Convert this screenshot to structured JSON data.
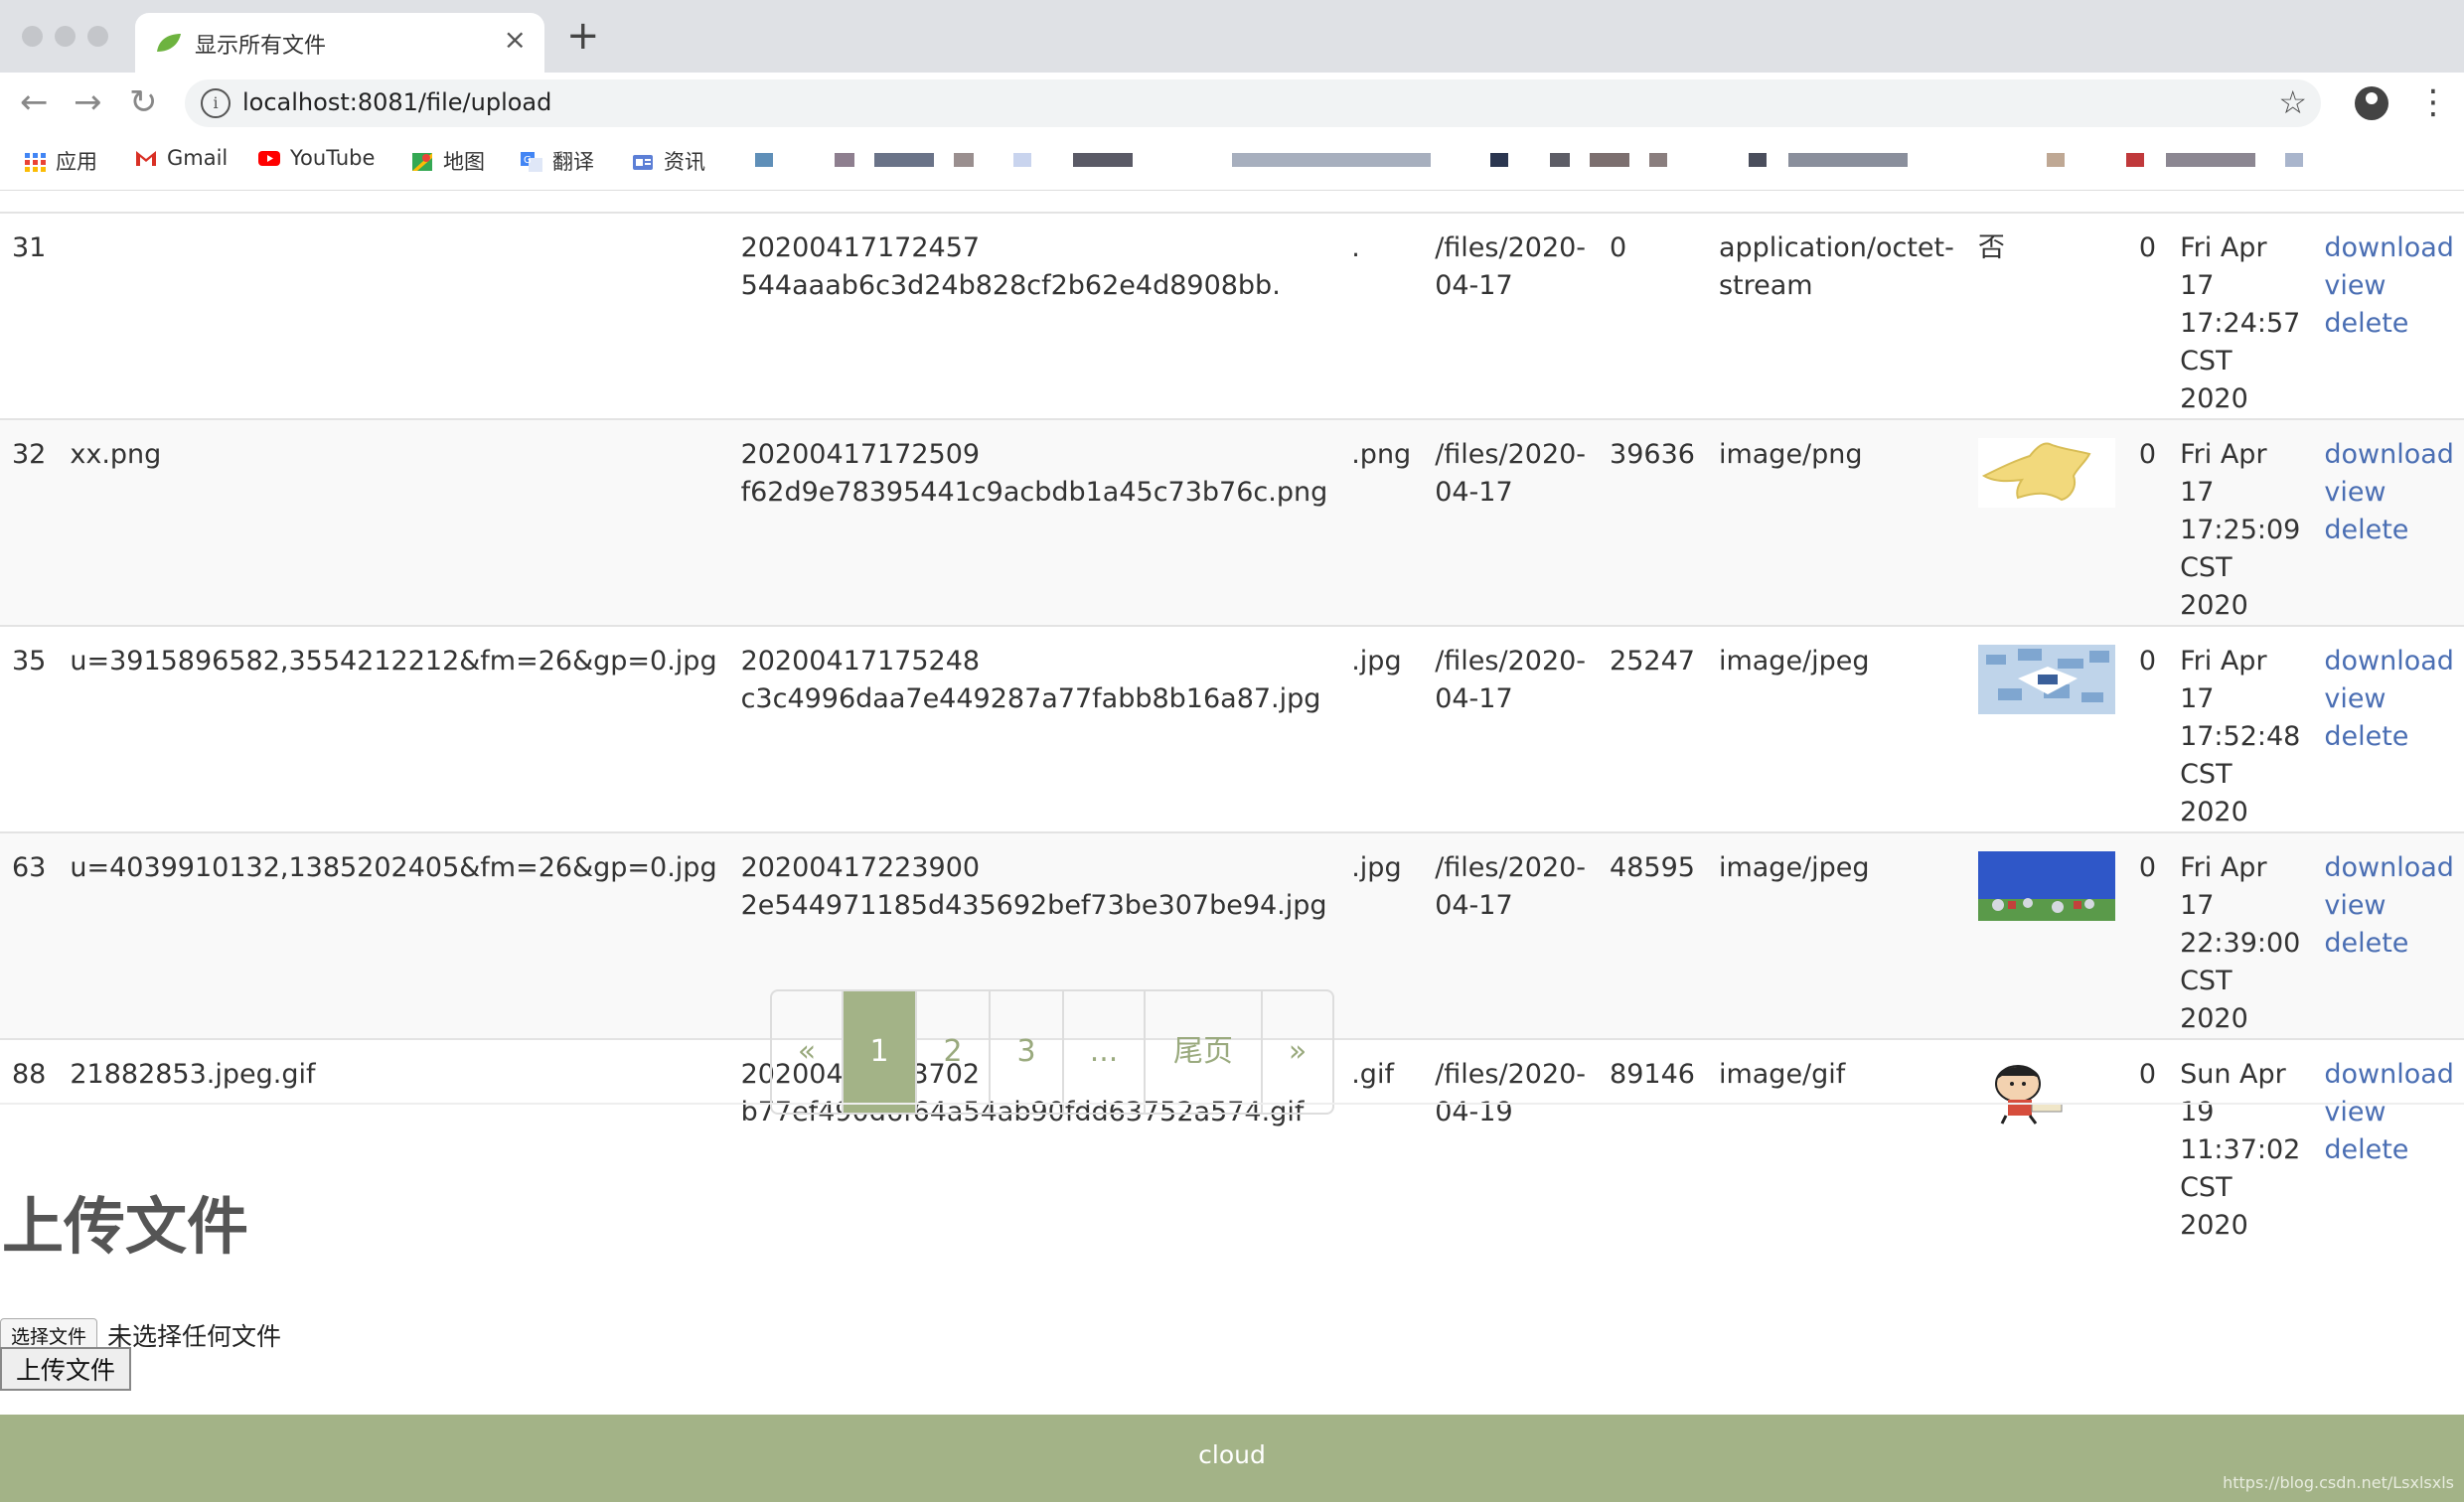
{
  "browser": {
    "tab_title": "显示所有文件",
    "url": "localhost:8081/file/upload",
    "bookmarks": [
      {
        "label": "应用",
        "icon": "apps-grid-icon"
      },
      {
        "label": "Gmail",
        "icon": "gmail-icon"
      },
      {
        "label": "YouTube",
        "icon": "youtube-icon"
      },
      {
        "label": "地图",
        "icon": "maps-icon"
      },
      {
        "label": "翻译",
        "icon": "translate-icon"
      },
      {
        "label": "资讯",
        "icon": "news-icon"
      }
    ]
  },
  "table": {
    "rows": [
      {
        "id": "31",
        "name": "",
        "stored_line1": "20200417172457",
        "stored_line2": "544aaab6c3d24b828cf2b62e4d8908bb.",
        "ext": ".",
        "path_line1": "/files/2020-",
        "path_line2": "04-17",
        "size": "0",
        "type_line1": "application/octet-",
        "type_line2": "stream",
        "preview_text": "否",
        "count": "0",
        "date_line1": "Fri Apr 17",
        "date_line2": "17:24:57 CST",
        "date_line3": "2020",
        "download": "download",
        "view": "view",
        "delete": "delete"
      },
      {
        "id": "32",
        "name": "xx.png",
        "stored_line1": "20200417172509",
        "stored_line2": "f62d9e78395441c9acbdb1a45c73b76c.png",
        "ext": ".png",
        "path_line1": "/files/2020-",
        "path_line2": "04-17",
        "size": "39636",
        "type_line1": "image/png",
        "type_line2": "",
        "preview_text": "",
        "count": "0",
        "date_line1": "Fri Apr 17",
        "date_line2": "17:25:09 CST",
        "date_line3": "2020",
        "download": "download",
        "view": "view",
        "delete": "delete"
      },
      {
        "id": "35",
        "name": "u=3915896582,3554212212&fm=26&gp=0.jpg",
        "stored_line1": "20200417175248",
        "stored_line2": "c3c4996daa7e449287a77fabb8b16a87.jpg",
        "ext": ".jpg",
        "path_line1": "/files/2020-",
        "path_line2": "04-17",
        "size": "25247",
        "type_line1": "image/jpeg",
        "type_line2": "",
        "preview_text": "",
        "count": "0",
        "date_line1": "Fri Apr 17",
        "date_line2": "17:52:48 CST",
        "date_line3": "2020",
        "download": "download",
        "view": "view",
        "delete": "delete"
      },
      {
        "id": "63",
        "name": "u=4039910132,1385202405&fm=26&gp=0.jpg",
        "stored_line1": "20200417223900",
        "stored_line2": "2e544971185d435692bef73be307be94.jpg",
        "ext": ".jpg",
        "path_line1": "/files/2020-",
        "path_line2": "04-17",
        "size": "48595",
        "type_line1": "image/jpeg",
        "type_line2": "",
        "preview_text": "",
        "count": "0",
        "date_line1": "Fri Apr 17",
        "date_line2": "22:39:00 CST",
        "date_line3": "2020",
        "download": "download",
        "view": "view",
        "delete": "delete"
      },
      {
        "id": "88",
        "name": "21882853.jpeg.gif",
        "stored_line1": "20200419113702",
        "stored_line2": "b77ef490d6f64a54ab90fdd63752a574.gif",
        "ext": ".gif",
        "path_line1": "/files/2020-",
        "path_line2": "04-19",
        "size": "89146",
        "type_line1": "image/gif",
        "type_line2": "",
        "preview_text": "",
        "count": "0",
        "date_line1": "Sun Apr 19",
        "date_line2": "11:37:02 CST",
        "date_line3": "2020",
        "download": "download",
        "view": "view",
        "delete": "delete"
      }
    ]
  },
  "pagination": {
    "prev": "«",
    "pages": [
      "1",
      "2",
      "3",
      "..."
    ],
    "last": "尾页",
    "next": "»",
    "active": "1"
  },
  "upload": {
    "title": "上传文件",
    "choose_label": "选择文件",
    "no_file": "未选择任何文件",
    "submit": "上传文件"
  },
  "footer": {
    "brand": "cloud",
    "watermark": "https://blog.csdn.net/Lsxlsxls"
  },
  "colors": {
    "accent": "#a3b387",
    "link": "#4a6eb3"
  }
}
